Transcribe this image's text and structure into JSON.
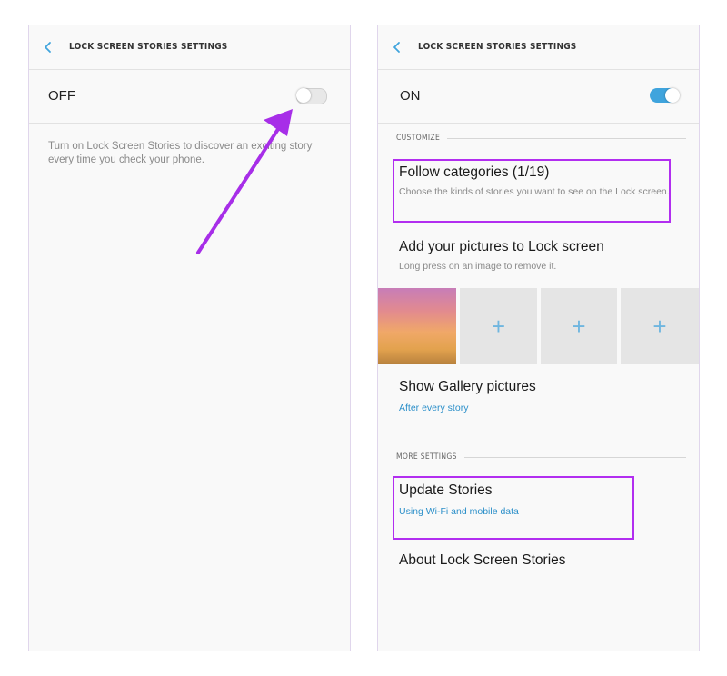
{
  "left_screen": {
    "title": "LOCK SCREEN STORIES SETTINGS",
    "switch_label": "OFF",
    "switch_state": "off",
    "description": "Turn on Lock Screen Stories to discover an exciting story every time you check your phone."
  },
  "right_screen": {
    "title": "LOCK SCREEN STORIES SETTINGS",
    "switch_label": "ON",
    "switch_state": "on",
    "customize_header": "CUSTOMIZE",
    "follow_categories": {
      "title": "Follow categories (1/19)",
      "subtitle": "Choose the kinds of stories you want to see on the Lock screen."
    },
    "add_pictures": {
      "title": "Add your pictures to Lock screen",
      "subtitle": "Long press on an image to remove it."
    },
    "picture_slots": [
      "+",
      "+",
      "+"
    ],
    "show_gallery": {
      "title": "Show Gallery pictures",
      "subtitle": "After every story"
    },
    "more_settings_header": "MORE SETTINGS",
    "update_stories": {
      "title": "Update Stories",
      "subtitle": "Using Wi-Fi and mobile data"
    },
    "about": {
      "title": "About Lock Screen Stories"
    }
  },
  "colors": {
    "accent": "#3fa4dd",
    "highlight": "#b22ef0",
    "arrow": "#a72ee8"
  }
}
